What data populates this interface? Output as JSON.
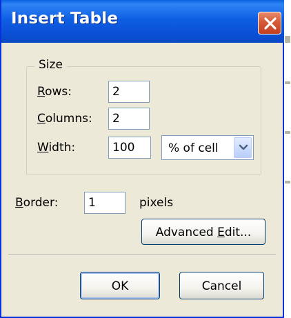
{
  "window": {
    "title": "Insert Table"
  },
  "size_group": {
    "legend": "Size",
    "rows": {
      "label_u": "R",
      "label_rest": "ows:",
      "value": "2"
    },
    "columns": {
      "label_u": "C",
      "label_rest": "olumns:",
      "value": "2"
    },
    "width": {
      "label_u": "W",
      "label_rest": "idth:",
      "value": "100",
      "unit": "% of cell"
    }
  },
  "border": {
    "label_u": "B",
    "label_rest": "order:",
    "value": "1",
    "unit": "pixels"
  },
  "buttons": {
    "advanced_pre": "Advanced ",
    "advanced_u": "E",
    "advanced_post": "dit...",
    "ok": "OK",
    "cancel": "Cancel"
  },
  "colors": {
    "titlebar": "#0a4fd6",
    "dialog_face": "#ece9d8",
    "close_button": "#d55a37"
  },
  "icons": {
    "close": "close-icon",
    "dropdown": "chevron-down-icon"
  }
}
